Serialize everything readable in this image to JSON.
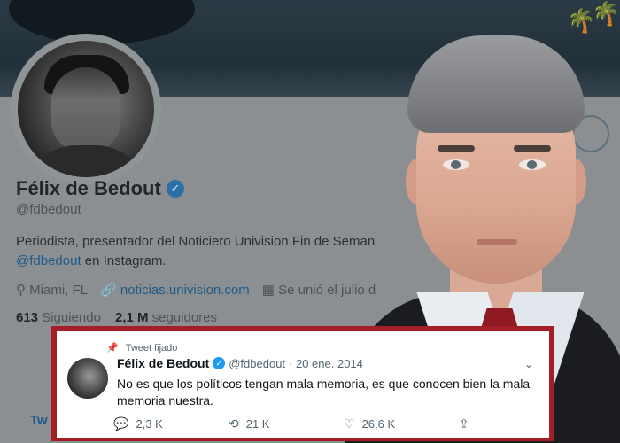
{
  "profile": {
    "name": "Félix de Bedout",
    "handle": "@fdbedout",
    "bio_line1": "Periodista, presentador del Noticiero Univision Fin de Seman",
    "bio_link": "@fdbedout",
    "bio_suffix": " en Instagram.",
    "location": "Miami, FL",
    "website": "noticias.univision.com",
    "joined": "Se unió el julio d",
    "following_count": "613",
    "following_label": "Siguiendo",
    "followers_count": "2,1 M",
    "followers_label": "seguidores",
    "tab_fragment": "Tw"
  },
  "tweet": {
    "pinned_label": "Tweet fijado",
    "name": "Félix de Bedout",
    "handle": "@fdbedout",
    "date": "· 20 ene. 2014",
    "text": "No es que los políticos tengan mala memoria, es que conocen bien la mala memoria nuestra.",
    "replies": "2,3 K",
    "retweets": "21 K",
    "likes": "26,6 K"
  },
  "icons": {
    "verified": "verified-badge-icon",
    "pin": "pin-icon",
    "location": "location-pin-icon",
    "link": "link-icon",
    "calendar": "calendar-icon",
    "reply": "reply-icon",
    "retweet": "retweet-icon",
    "like": "heart-icon",
    "share": "share-icon",
    "more": "chevron-down-icon"
  },
  "colors": {
    "accent": "#1d9bf0",
    "card_border": "#a61e25",
    "tie": "#8f1a22"
  }
}
